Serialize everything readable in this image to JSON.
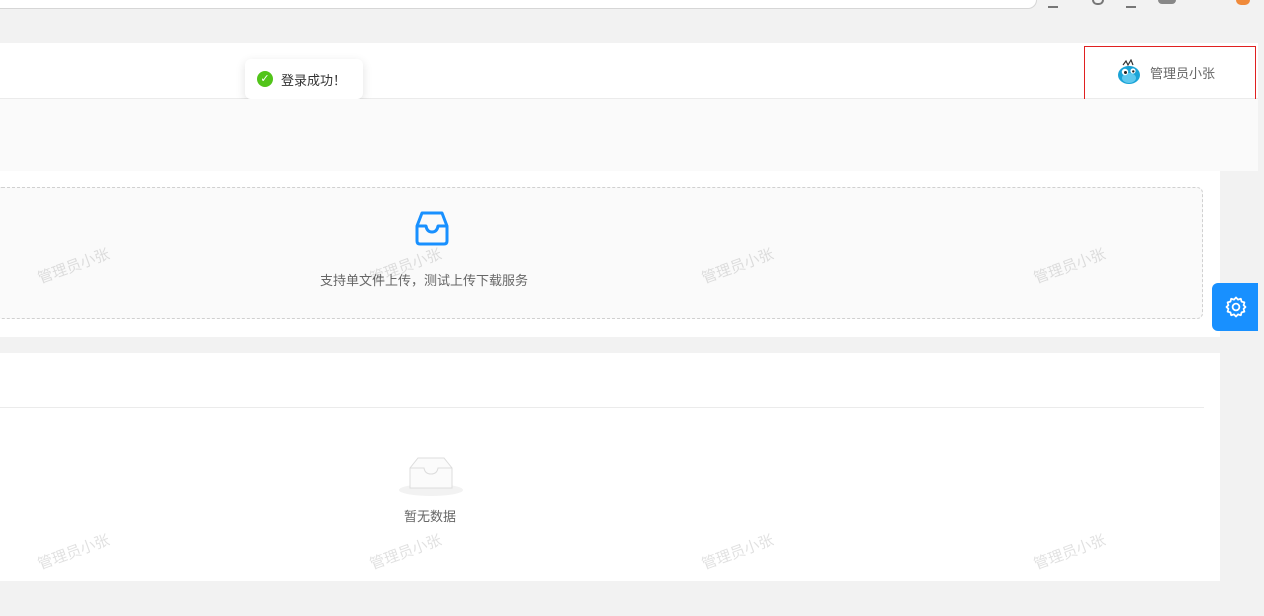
{
  "toast": {
    "message": "登录成功！",
    "icon": "check-circle-icon",
    "color": "#52c41a"
  },
  "header": {
    "user_name": "管理员小张",
    "avatar": "avatar-bird-icon"
  },
  "upload": {
    "icon": "inbox-icon",
    "hint": "支持单文件上传，测试上传下载服务",
    "accent": "#1890ff"
  },
  "list": {
    "empty_text": "暂无数据",
    "empty_icon": "empty-box-icon"
  },
  "settings": {
    "icon": "gear-icon",
    "color": "#1890ff"
  },
  "watermark": {
    "text": "管理员小张"
  },
  "highlight": {
    "color": "#e02020"
  }
}
